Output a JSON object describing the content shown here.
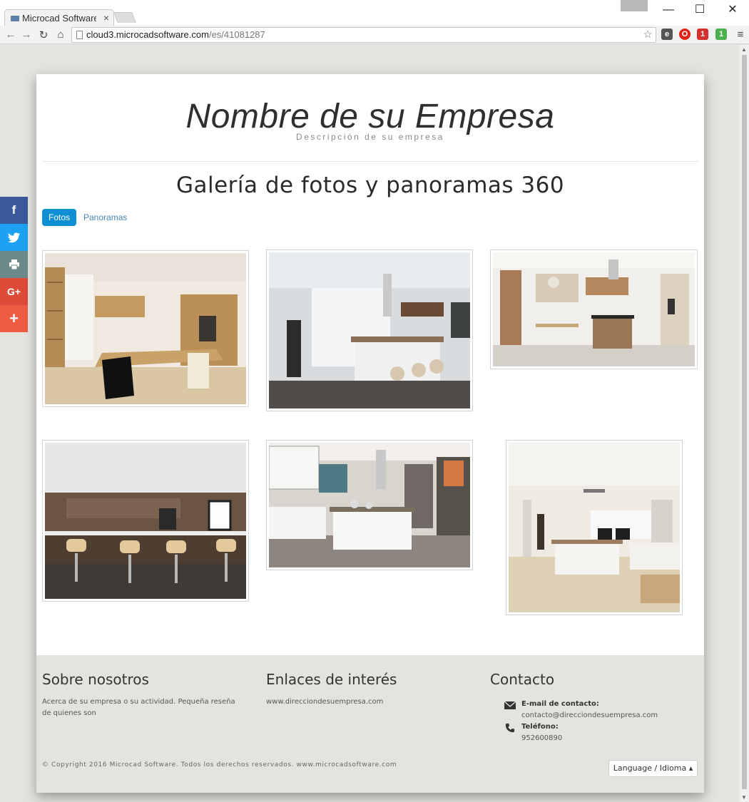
{
  "browser": {
    "tab_title": "Microcad Software - ",
    "tab_close": "×",
    "url_host": "cloud3.microcadsoftware.com",
    "url_path": "/es/41081287",
    "window_controls": {
      "minimize": "—",
      "maximize": "☐",
      "close": "✕"
    },
    "ext_badges": [
      "1",
      "1"
    ]
  },
  "header": {
    "brand": "Nombre de su Empresa",
    "tagline": "Descripción de su empresa"
  },
  "gallery": {
    "title": "Galería de fotos y panoramas 360",
    "tabs": [
      {
        "label": "Fotos",
        "active": true
      },
      {
        "label": "Panoramas",
        "active": false
      }
    ]
  },
  "social": [
    "f",
    "t",
    "print",
    "G+",
    "+"
  ],
  "footer": {
    "about": {
      "title": "Sobre nosotros",
      "text": "Acerca de su empresa o su actividad. Pequeña reseña de quienes son"
    },
    "links": {
      "title": "Enlaces de interés",
      "url": "www.direcciondesuempresa.com"
    },
    "contact": {
      "title": "Contacto",
      "email_label": "E-mail de contacto:",
      "email": "contacto@direcciondesuempresa.com",
      "phone_label": "Teléfono:",
      "phone": "952600890"
    },
    "copyright": "© Copyright 2016 Microcad Software. Todos los derechos reservados. www.microcadsoftware.com",
    "language_button": "Language / Idioma ▴"
  },
  "colors": {
    "accent": "#0f8fd3",
    "facebook": "#3b5998",
    "twitter": "#1da1f2",
    "print": "#6d8a8a",
    "google": "#dd4b39",
    "share": "#ef5b43"
  }
}
